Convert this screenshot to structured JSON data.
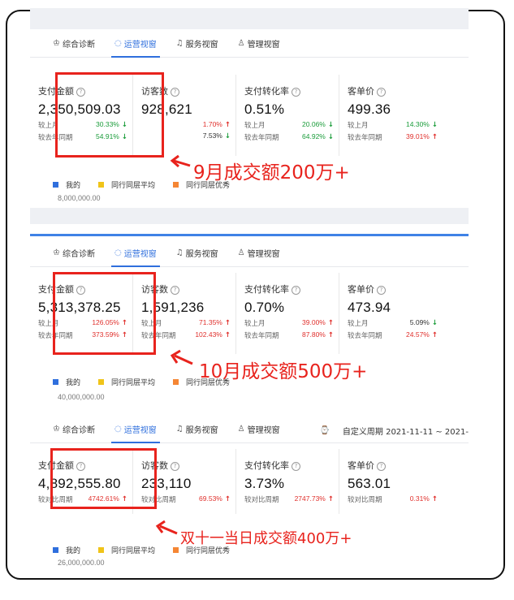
{
  "colors": {
    "accent": "#2f6fdd",
    "up": "#e0302c",
    "down": "#1a9c3a",
    "highlight": "#e8231d",
    "legend_mine": "#2f6fdd",
    "legend_avg": "#f0c419",
    "legend_top": "#f58634"
  },
  "panels": [
    {
      "tabs": [
        {
          "icon": "diagnosis-icon",
          "glyph": "♔",
          "label": "综合诊断"
        },
        {
          "icon": "operation-icon",
          "glyph": "◌",
          "label": "运营视窗"
        },
        {
          "icon": "headset-icon",
          "glyph": "♫",
          "label": "服务视窗"
        },
        {
          "icon": "manage-icon",
          "glyph": "♙",
          "label": "管理视窗"
        }
      ],
      "metrics": [
        {
          "label": "支付金额",
          "value": "2,350,509.03",
          "rows": [
            {
              "label": "较上月",
              "pct": "30.33%",
              "dir": "down"
            },
            {
              "label": "较去年同期",
              "pct": "54.91%",
              "dir": "down"
            }
          ]
        },
        {
          "label": "访客数",
          "value": "928,621",
          "rows": [
            {
              "label": "",
              "pct": "1.70%",
              "dir": "up"
            },
            {
              "label": "",
              "pct": "7.53%",
              "dir": "down"
            }
          ]
        },
        {
          "label": "支付转化率",
          "value": "0.51%",
          "rows": [
            {
              "label": "较上月",
              "pct": "20.06%",
              "dir": "down"
            },
            {
              "label": "较去年同期",
              "pct": "64.92%",
              "dir": "down"
            }
          ]
        },
        {
          "label": "客单价",
          "value": "499.36",
          "rows": [
            {
              "label": "较上月",
              "pct": "14.30%",
              "dir": "down"
            },
            {
              "label": "较去年同期",
              "pct": "39.01%",
              "dir": "up"
            }
          ]
        }
      ],
      "legend": [
        "我的",
        "同行同层平均",
        "同行同层优秀"
      ],
      "axis_value": "8,000,000.00",
      "annotation": "9月成交额200万+"
    },
    {
      "tabs": [
        {
          "icon": "diagnosis-icon",
          "glyph": "♔",
          "label": "综合诊断"
        },
        {
          "icon": "operation-icon",
          "glyph": "◌",
          "label": "运营视窗"
        },
        {
          "icon": "headset-icon",
          "glyph": "♫",
          "label": "服务视窗"
        },
        {
          "icon": "manage-icon",
          "glyph": "♙",
          "label": "管理视窗"
        }
      ],
      "metrics": [
        {
          "label": "支付金额",
          "value": "5,313,378.25",
          "rows": [
            {
              "label": "较上月",
              "pct": "126.05%",
              "dir": "up"
            },
            {
              "label": "较去年同期",
              "pct": "373.59%",
              "dir": "up"
            }
          ]
        },
        {
          "label": "访客数",
          "value": "1,591,236",
          "rows": [
            {
              "label": "较上月",
              "pct": "71.35%",
              "dir": "up"
            },
            {
              "label": "较去年同期",
              "pct": "102.43%",
              "dir": "up"
            }
          ]
        },
        {
          "label": "支付转化率",
          "value": "0.70%",
          "rows": [
            {
              "label": "较上月",
              "pct": "39.00%",
              "dir": "up"
            },
            {
              "label": "较去年同期",
              "pct": "87.80%",
              "dir": "up"
            }
          ]
        },
        {
          "label": "客单价",
          "value": "473.94",
          "rows": [
            {
              "label": "较上月",
              "pct": "5.09%",
              "dir": "down"
            },
            {
              "label": "较去年同期",
              "pct": "24.57%",
              "dir": "up"
            }
          ]
        }
      ],
      "legend": [
        "我的",
        "同行同层平均",
        "同行同层优秀"
      ],
      "axis_value": "40,000,000.00",
      "annotation": "10月成交额500万+"
    },
    {
      "tabs": [
        {
          "icon": "diagnosis-icon",
          "glyph": "♔",
          "label": "综合诊断"
        },
        {
          "icon": "operation-icon",
          "glyph": "◌",
          "label": "运营视窗"
        },
        {
          "icon": "headset-icon",
          "glyph": "♫",
          "label": "服务视窗"
        },
        {
          "icon": "manage-icon",
          "glyph": "♙",
          "label": "管理视窗"
        }
      ],
      "period": "自定义周期 2021-11-11 ~ 2021-",
      "metrics": [
        {
          "label": "支付金额",
          "value": "4,892,555.80",
          "rows": [
            {
              "label": "较对比周期",
              "pct": "4742.61%",
              "dir": "up"
            }
          ]
        },
        {
          "label": "访客数",
          "value": "233,110",
          "rows": [
            {
              "label": "较对比周期",
              "pct": "69.53%",
              "dir": "up"
            }
          ]
        },
        {
          "label": "支付转化率",
          "value": "3.73%",
          "rows": [
            {
              "label": "较对比周期",
              "pct": "2747.73%",
              "dir": "up"
            }
          ]
        },
        {
          "label": "客单价",
          "value": "563.01",
          "rows": [
            {
              "label": "较对比周期",
              "pct": "0.31%",
              "dir": "up"
            }
          ]
        }
      ],
      "legend": [
        "我的",
        "同行同层平均",
        "同行同层优秀"
      ],
      "axis_value": "26,000,000.00",
      "annotation": "双十一当日成交额400万+"
    }
  ]
}
